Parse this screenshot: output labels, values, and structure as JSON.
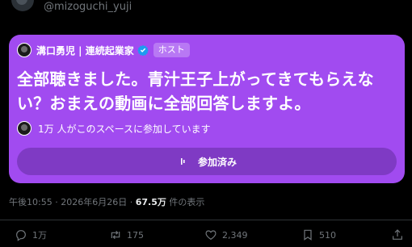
{
  "author": {
    "handle": "@mizoguchi_yuji"
  },
  "space": {
    "host_name": "溝口勇児 | 連続起業家",
    "host_badge": "ホスト",
    "title": "全部聴きました。青汁王子上がってきてもらえない？おまえの動画に全部回答しますよ。",
    "listeners_text": "1万 人がこのスペースに参加しています",
    "joined_label": "参加済み",
    "card_color": "#a14bf0"
  },
  "meta": {
    "time": "午後10:55",
    "separator": " · ",
    "date": "2026年6月26日",
    "views_count": "67.5万",
    "views_label": " 件の表示"
  },
  "actions": {
    "reply_count": "1万",
    "repost_count": "175",
    "like_count": "2,349",
    "bookmark_count": "510"
  }
}
